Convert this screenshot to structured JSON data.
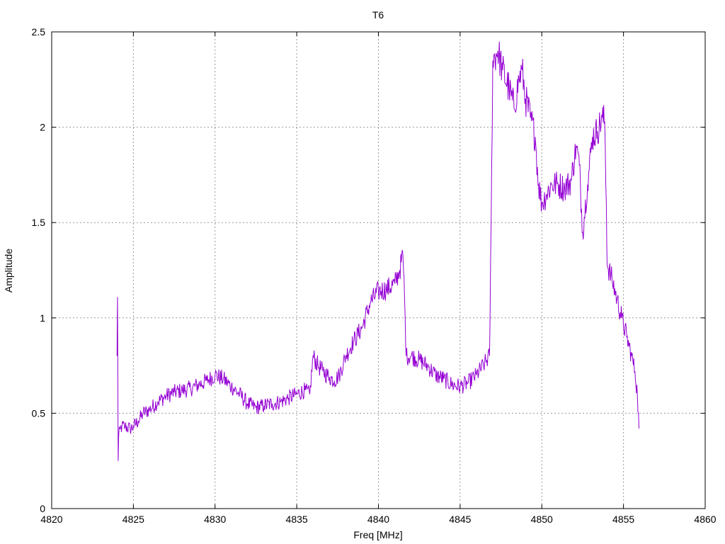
{
  "chart_data": {
    "type": "line",
    "title": "T6",
    "xlabel": "Freq [MHz]",
    "ylabel": "Amplitude",
    "xlim": [
      4820,
      4860
    ],
    "ylim": [
      0,
      2.5
    ],
    "xticks": [
      4820,
      4825,
      4830,
      4835,
      4840,
      4845,
      4850,
      4855,
      4860
    ],
    "yticks": [
      0,
      0.5,
      1,
      1.5,
      2,
      2.5
    ],
    "xtick_labels": [
      "4820",
      "4825",
      "4830",
      "4835",
      "4840",
      "4845",
      "4850",
      "4855",
      "4860"
    ],
    "ytick_labels": [
      "0",
      "0.5",
      "1",
      "1.5",
      "2",
      "2.5"
    ],
    "grid": true,
    "series_color": "#9400d3",
    "series": [
      {
        "x": [
          4824.0,
          4824.03,
          4824.07,
          4824.1,
          4824.2,
          4824.3,
          4824.5,
          4824.8,
          4825.0,
          4825.3,
          4825.6,
          4826.0,
          4826.5,
          4827.0,
          4827.5,
          4828.0,
          4828.5,
          4829.0,
          4829.5,
          4830.0,
          4830.5,
          4831.0,
          4831.5,
          4832.0,
          4832.5,
          4833.0,
          4833.5,
          4834.0,
          4834.5,
          4835.0,
          4835.5,
          4835.8,
          4836.0,
          4836.3,
          4836.6,
          4837.0,
          4837.3,
          4837.6,
          4838.0,
          4838.5,
          4839.0,
          4839.5,
          4840.0,
          4840.5,
          4841.0,
          4841.3,
          4841.5,
          4841.6,
          4841.7,
          4842.0,
          4842.5,
          4843.0,
          4843.5,
          4844.0,
          4844.5,
          4845.0,
          4845.5,
          4846.0,
          4846.5,
          4846.8,
          4846.9,
          4847.0,
          4847.3,
          4847.6,
          4848.0,
          4848.3,
          4848.6,
          4848.8,
          4849.0,
          4849.3,
          4849.6,
          4849.8,
          4850.0,
          4850.3,
          4850.6,
          4851.0,
          4851.4,
          4851.8,
          4852.1,
          4852.3,
          4852.5,
          4852.8,
          4853.1,
          4853.4,
          4853.7,
          4853.85,
          4853.95,
          4854.0,
          4854.3,
          4854.6,
          4854.9,
          4855.2,
          4855.5,
          4855.7,
          4855.85,
          4855.95
        ],
        "y": [
          0.8,
          1.11,
          0.25,
          0.38,
          0.42,
          0.43,
          0.43,
          0.42,
          0.43,
          0.46,
          0.5,
          0.52,
          0.56,
          0.59,
          0.61,
          0.62,
          0.63,
          0.65,
          0.67,
          0.7,
          0.68,
          0.64,
          0.6,
          0.55,
          0.53,
          0.54,
          0.55,
          0.56,
          0.58,
          0.6,
          0.62,
          0.6,
          0.8,
          0.75,
          0.72,
          0.69,
          0.67,
          0.7,
          0.8,
          0.88,
          0.95,
          1.08,
          1.14,
          1.15,
          1.18,
          1.25,
          1.33,
          1.1,
          0.8,
          0.8,
          0.78,
          0.75,
          0.7,
          0.68,
          0.65,
          0.64,
          0.66,
          0.7,
          0.76,
          0.8,
          1.5,
          2.35,
          2.4,
          2.3,
          2.2,
          2.1,
          2.25,
          2.3,
          2.15,
          2.05,
          1.95,
          1.7,
          1.6,
          1.65,
          1.7,
          1.7,
          1.68,
          1.72,
          1.9,
          1.8,
          1.45,
          1.7,
          1.95,
          1.98,
          2.05,
          2.03,
          1.6,
          1.28,
          1.2,
          1.1,
          1.0,
          0.9,
          0.8,
          0.72,
          0.6,
          0.42
        ]
      }
    ]
  }
}
